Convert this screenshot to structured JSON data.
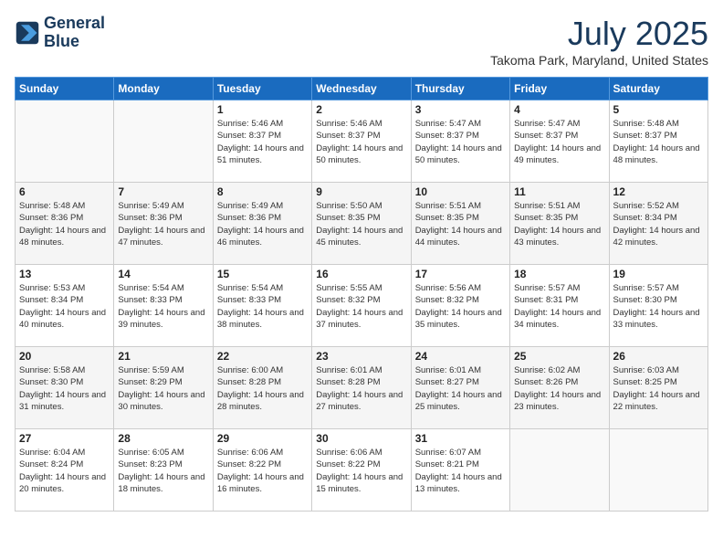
{
  "header": {
    "logo_line1": "General",
    "logo_line2": "Blue",
    "month_year": "July 2025",
    "location": "Takoma Park, Maryland, United States"
  },
  "weekdays": [
    "Sunday",
    "Monday",
    "Tuesday",
    "Wednesday",
    "Thursday",
    "Friday",
    "Saturday"
  ],
  "weeks": [
    [
      {
        "day": "",
        "sunrise": "",
        "sunset": "",
        "daylight": ""
      },
      {
        "day": "",
        "sunrise": "",
        "sunset": "",
        "daylight": ""
      },
      {
        "day": "1",
        "sunrise": "Sunrise: 5:46 AM",
        "sunset": "Sunset: 8:37 PM",
        "daylight": "Daylight: 14 hours and 51 minutes."
      },
      {
        "day": "2",
        "sunrise": "Sunrise: 5:46 AM",
        "sunset": "Sunset: 8:37 PM",
        "daylight": "Daylight: 14 hours and 50 minutes."
      },
      {
        "day": "3",
        "sunrise": "Sunrise: 5:47 AM",
        "sunset": "Sunset: 8:37 PM",
        "daylight": "Daylight: 14 hours and 50 minutes."
      },
      {
        "day": "4",
        "sunrise": "Sunrise: 5:47 AM",
        "sunset": "Sunset: 8:37 PM",
        "daylight": "Daylight: 14 hours and 49 minutes."
      },
      {
        "day": "5",
        "sunrise": "Sunrise: 5:48 AM",
        "sunset": "Sunset: 8:37 PM",
        "daylight": "Daylight: 14 hours and 48 minutes."
      }
    ],
    [
      {
        "day": "6",
        "sunrise": "Sunrise: 5:48 AM",
        "sunset": "Sunset: 8:36 PM",
        "daylight": "Daylight: 14 hours and 48 minutes."
      },
      {
        "day": "7",
        "sunrise": "Sunrise: 5:49 AM",
        "sunset": "Sunset: 8:36 PM",
        "daylight": "Daylight: 14 hours and 47 minutes."
      },
      {
        "day": "8",
        "sunrise": "Sunrise: 5:49 AM",
        "sunset": "Sunset: 8:36 PM",
        "daylight": "Daylight: 14 hours and 46 minutes."
      },
      {
        "day": "9",
        "sunrise": "Sunrise: 5:50 AM",
        "sunset": "Sunset: 8:35 PM",
        "daylight": "Daylight: 14 hours and 45 minutes."
      },
      {
        "day": "10",
        "sunrise": "Sunrise: 5:51 AM",
        "sunset": "Sunset: 8:35 PM",
        "daylight": "Daylight: 14 hours and 44 minutes."
      },
      {
        "day": "11",
        "sunrise": "Sunrise: 5:51 AM",
        "sunset": "Sunset: 8:35 PM",
        "daylight": "Daylight: 14 hours and 43 minutes."
      },
      {
        "day": "12",
        "sunrise": "Sunrise: 5:52 AM",
        "sunset": "Sunset: 8:34 PM",
        "daylight": "Daylight: 14 hours and 42 minutes."
      }
    ],
    [
      {
        "day": "13",
        "sunrise": "Sunrise: 5:53 AM",
        "sunset": "Sunset: 8:34 PM",
        "daylight": "Daylight: 14 hours and 40 minutes."
      },
      {
        "day": "14",
        "sunrise": "Sunrise: 5:54 AM",
        "sunset": "Sunset: 8:33 PM",
        "daylight": "Daylight: 14 hours and 39 minutes."
      },
      {
        "day": "15",
        "sunrise": "Sunrise: 5:54 AM",
        "sunset": "Sunset: 8:33 PM",
        "daylight": "Daylight: 14 hours and 38 minutes."
      },
      {
        "day": "16",
        "sunrise": "Sunrise: 5:55 AM",
        "sunset": "Sunset: 8:32 PM",
        "daylight": "Daylight: 14 hours and 37 minutes."
      },
      {
        "day": "17",
        "sunrise": "Sunrise: 5:56 AM",
        "sunset": "Sunset: 8:32 PM",
        "daylight": "Daylight: 14 hours and 35 minutes."
      },
      {
        "day": "18",
        "sunrise": "Sunrise: 5:57 AM",
        "sunset": "Sunset: 8:31 PM",
        "daylight": "Daylight: 14 hours and 34 minutes."
      },
      {
        "day": "19",
        "sunrise": "Sunrise: 5:57 AM",
        "sunset": "Sunset: 8:30 PM",
        "daylight": "Daylight: 14 hours and 33 minutes."
      }
    ],
    [
      {
        "day": "20",
        "sunrise": "Sunrise: 5:58 AM",
        "sunset": "Sunset: 8:30 PM",
        "daylight": "Daylight: 14 hours and 31 minutes."
      },
      {
        "day": "21",
        "sunrise": "Sunrise: 5:59 AM",
        "sunset": "Sunset: 8:29 PM",
        "daylight": "Daylight: 14 hours and 30 minutes."
      },
      {
        "day": "22",
        "sunrise": "Sunrise: 6:00 AM",
        "sunset": "Sunset: 8:28 PM",
        "daylight": "Daylight: 14 hours and 28 minutes."
      },
      {
        "day": "23",
        "sunrise": "Sunrise: 6:01 AM",
        "sunset": "Sunset: 8:28 PM",
        "daylight": "Daylight: 14 hours and 27 minutes."
      },
      {
        "day": "24",
        "sunrise": "Sunrise: 6:01 AM",
        "sunset": "Sunset: 8:27 PM",
        "daylight": "Daylight: 14 hours and 25 minutes."
      },
      {
        "day": "25",
        "sunrise": "Sunrise: 6:02 AM",
        "sunset": "Sunset: 8:26 PM",
        "daylight": "Daylight: 14 hours and 23 minutes."
      },
      {
        "day": "26",
        "sunrise": "Sunrise: 6:03 AM",
        "sunset": "Sunset: 8:25 PM",
        "daylight": "Daylight: 14 hours and 22 minutes."
      }
    ],
    [
      {
        "day": "27",
        "sunrise": "Sunrise: 6:04 AM",
        "sunset": "Sunset: 8:24 PM",
        "daylight": "Daylight: 14 hours and 20 minutes."
      },
      {
        "day": "28",
        "sunrise": "Sunrise: 6:05 AM",
        "sunset": "Sunset: 8:23 PM",
        "daylight": "Daylight: 14 hours and 18 minutes."
      },
      {
        "day": "29",
        "sunrise": "Sunrise: 6:06 AM",
        "sunset": "Sunset: 8:22 PM",
        "daylight": "Daylight: 14 hours and 16 minutes."
      },
      {
        "day": "30",
        "sunrise": "Sunrise: 6:06 AM",
        "sunset": "Sunset: 8:22 PM",
        "daylight": "Daylight: 14 hours and 15 minutes."
      },
      {
        "day": "31",
        "sunrise": "Sunrise: 6:07 AM",
        "sunset": "Sunset: 8:21 PM",
        "daylight": "Daylight: 14 hours and 13 minutes."
      },
      {
        "day": "",
        "sunrise": "",
        "sunset": "",
        "daylight": ""
      },
      {
        "day": "",
        "sunrise": "",
        "sunset": "",
        "daylight": ""
      }
    ]
  ]
}
